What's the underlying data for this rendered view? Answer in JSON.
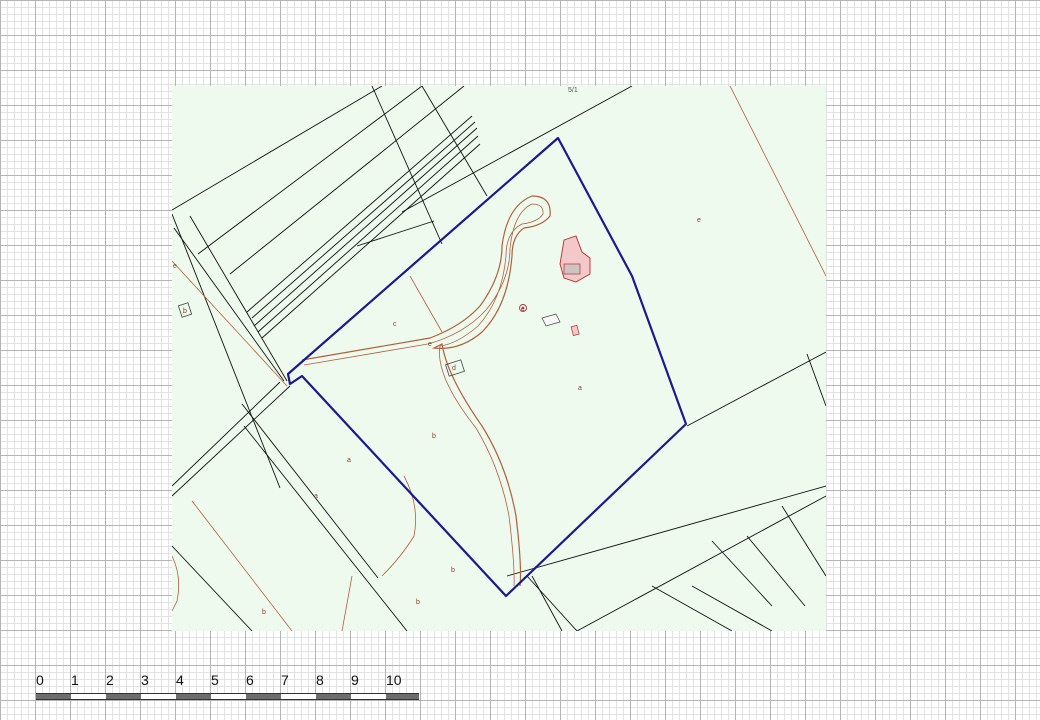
{
  "map": {
    "colors": {
      "parcel_fill": "#eefaee",
      "cadastral_line": "#111111",
      "boundary_line": "#b0603c",
      "highlight_boundary": "#1a1a8c",
      "building_fill": "#f2c8c8",
      "building_stroke": "#b03030"
    },
    "parcel_labels": [
      "a",
      "b",
      "c",
      "d",
      "e"
    ],
    "road_label": "5/1"
  },
  "scale": {
    "ticks": [
      "0",
      "1",
      "2",
      "3",
      "4",
      "5",
      "6",
      "7",
      "8",
      "9",
      "10"
    ],
    "colors": {
      "dark": "#6d6d6d",
      "light": "#ffffff"
    }
  }
}
